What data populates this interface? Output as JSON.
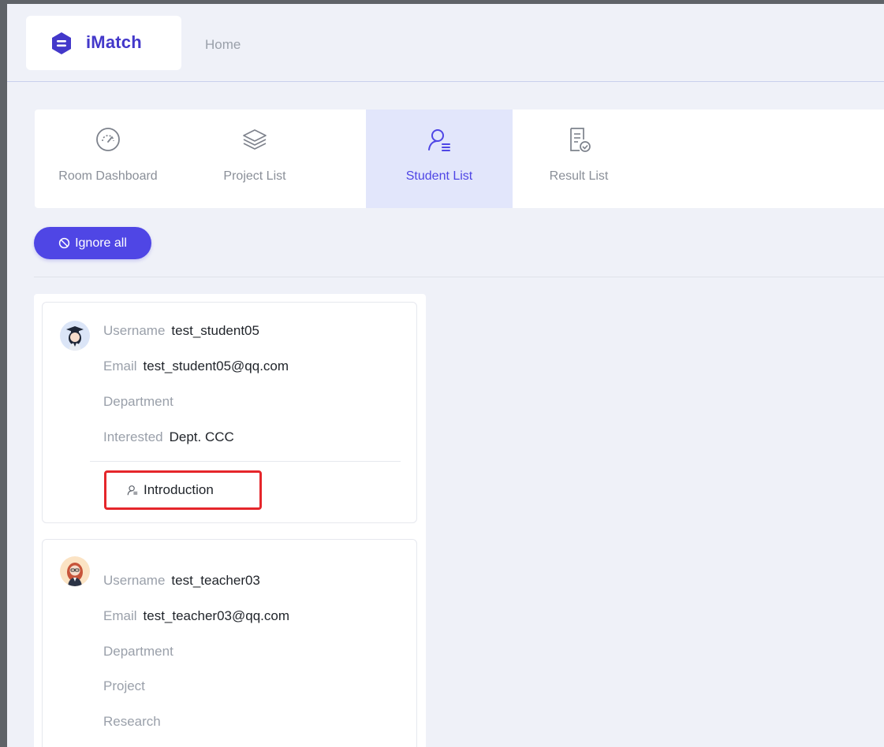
{
  "app": {
    "name": "iMatch",
    "brand_color": "#4f46e5"
  },
  "header": {
    "home_label": "Home"
  },
  "tabs": [
    {
      "label": "Room Dashboard",
      "icon": "dashboard-gauge-icon",
      "active": false
    },
    {
      "label": "Project List",
      "icon": "layers-icon",
      "active": false
    },
    {
      "label": "Student List",
      "icon": "user-list-icon",
      "active": true
    },
    {
      "label": "Result List",
      "icon": "document-check-icon",
      "active": false
    }
  ],
  "toolbar": {
    "ignore_all_label": "Ignore all",
    "ignore_icon": "ban-icon"
  },
  "cards": [
    {
      "fields": [
        {
          "key": "Username",
          "value": "test_student05"
        },
        {
          "key": "Email",
          "value": "test_student05@qq.com"
        },
        {
          "key": "Department",
          "value": ""
        },
        {
          "key": "Interested",
          "value": "Dept. CCC"
        }
      ],
      "action_label": "Introduction",
      "action_icon": "user-list-icon"
    },
    {
      "fields": [
        {
          "key": "Username",
          "value": "test_teacher03"
        },
        {
          "key": "Email",
          "value": "test_teacher03@qq.com"
        },
        {
          "key": "Department",
          "value": ""
        },
        {
          "key": "Project",
          "value": ""
        },
        {
          "key": "Research",
          "value": ""
        }
      ]
    }
  ]
}
